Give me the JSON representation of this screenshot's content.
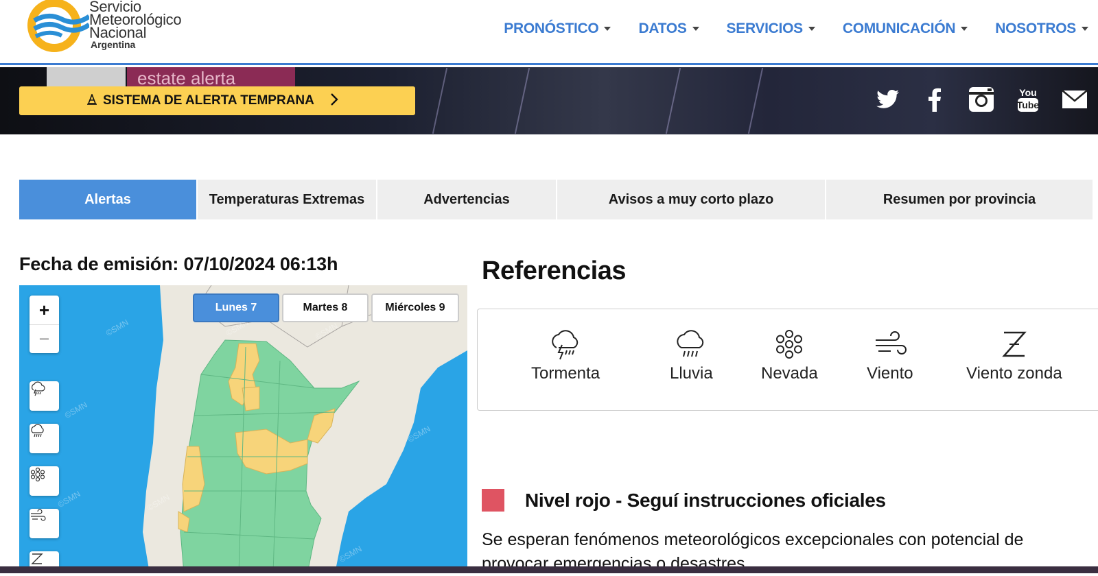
{
  "logo": {
    "line1": "Servicio",
    "line2": "Meteorológico",
    "line3": "Nacional",
    "line4": "Argentina"
  },
  "nav": {
    "items": [
      {
        "label": "PRONÓSTICO"
      },
      {
        "label": "DATOS"
      },
      {
        "label": "SERVICIOS"
      },
      {
        "label": "COMUNICACIÓN"
      },
      {
        "label": "NOSOTROS"
      }
    ]
  },
  "banner": {
    "overlay_text": "estate alerta",
    "alert_button_label": "SISTEMA DE ALERTA TEMPRANA",
    "social": [
      "twitter-icon",
      "facebook-icon",
      "instagram-icon",
      "youtube-icon",
      "email-icon"
    ]
  },
  "tabs": [
    {
      "label": "Alertas",
      "active": true
    },
    {
      "label": "Temperaturas Extremas",
      "active": false
    },
    {
      "label": "Advertencias",
      "active": false
    },
    {
      "label": "Avisos a muy corto plazo",
      "active": false
    },
    {
      "label": "Resumen por provincia",
      "active": false
    }
  ],
  "fecha": "Fecha de emisión: 07/10/2024 06:13h",
  "map": {
    "zoom_in": "+",
    "zoom_out": "−",
    "days": [
      {
        "label": "Lunes 7",
        "active": true
      },
      {
        "label": "Martes 8",
        "active": false
      },
      {
        "label": "Miércoles 9",
        "active": false
      }
    ],
    "layers": [
      "storm-icon",
      "rain-icon",
      "snow-icon",
      "wind-icon",
      "zonda-icon"
    ],
    "watermark": "©SMN",
    "colors": {
      "ocean": "#2aa4e6",
      "land": "#ebe8df",
      "green": "#7fd4a0",
      "yellow": "#f7d47a"
    }
  },
  "referencias": {
    "title": "Referencias",
    "items": [
      {
        "label": "Tormenta",
        "icon": "storm-icon"
      },
      {
        "label": "Lluvia",
        "icon": "rain-icon"
      },
      {
        "label": "Nevada",
        "icon": "snow-icon"
      },
      {
        "label": "Viento",
        "icon": "wind-icon"
      },
      {
        "label": "Viento zonda",
        "icon": "zonda-icon"
      }
    ]
  },
  "nivel": {
    "title": "Nivel rojo - Seguí instrucciones oficiales",
    "color": "#df5462",
    "desc": "Se esperan fenómenos meteorológicos excepcionales con potencial de provocar emergencias o desastres."
  }
}
